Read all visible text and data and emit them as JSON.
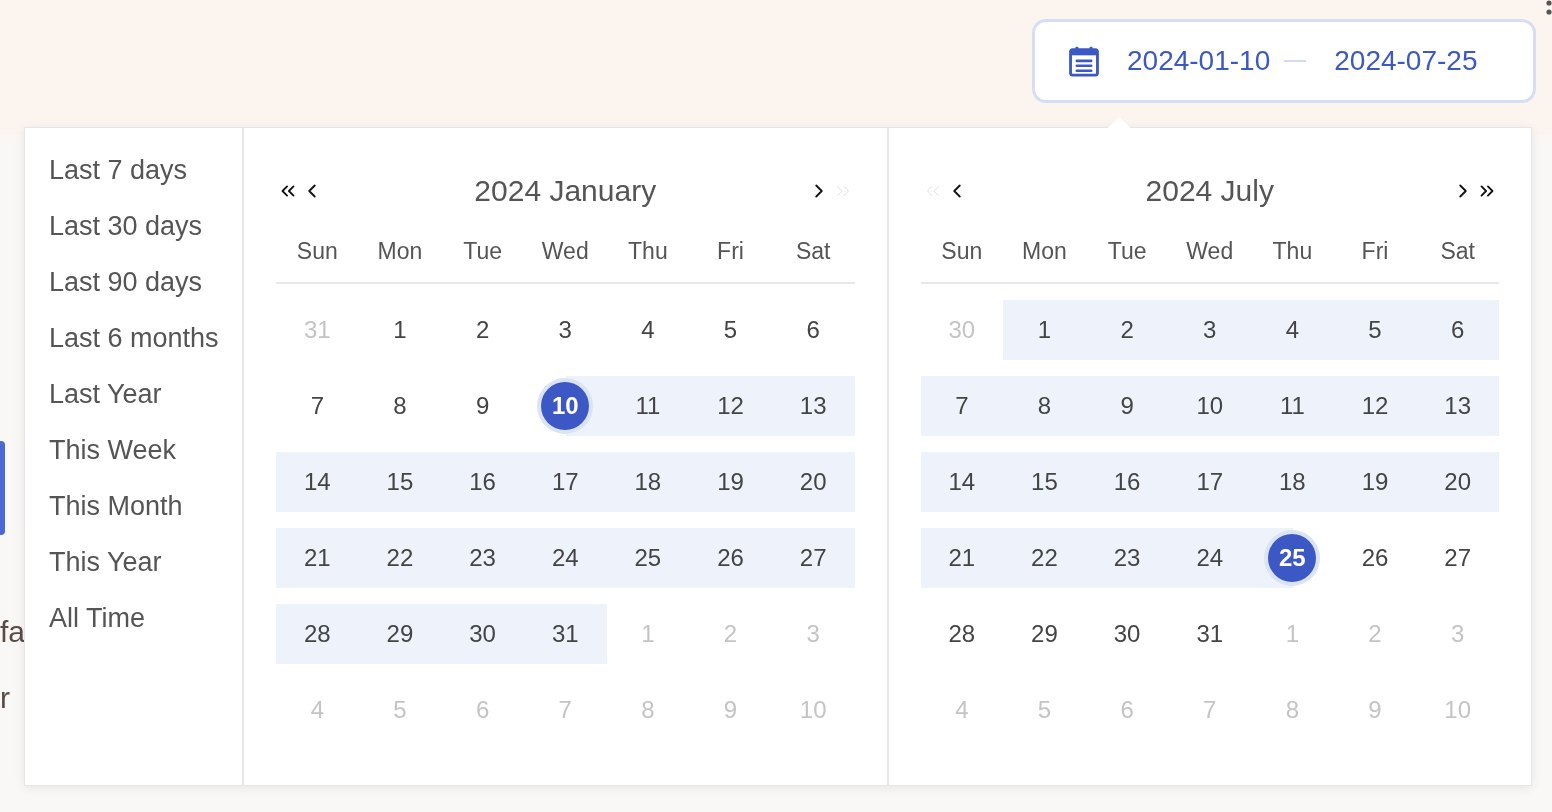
{
  "date_range_field": {
    "start": "2024-01-10",
    "end": "2024-07-25"
  },
  "background_fragments": [
    "fa",
    "r"
  ],
  "presets": [
    "Last 7 days",
    "Last 30 days",
    "Last 90 days",
    "Last 6 months",
    "Last Year",
    "This Week",
    "This Month",
    "This Year",
    "All Time"
  ],
  "calendars": [
    {
      "title": "2024 January",
      "nav": [
        {
          "kind": "prev_year",
          "disabled": false
        },
        {
          "kind": "prev_month",
          "disabled": false
        },
        {
          "kind": "next_month",
          "disabled": false
        },
        {
          "kind": "next_year",
          "disabled": true
        }
      ],
      "weekdays": [
        "Sun",
        "Mon",
        "Tue",
        "Wed",
        "Thu",
        "Fri",
        "Sat"
      ],
      "days": [
        {
          "label": "31",
          "outside": true,
          "in_range": false,
          "selected": false
        },
        {
          "label": "1",
          "outside": false,
          "in_range": false,
          "selected": false
        },
        {
          "label": "2",
          "outside": false,
          "in_range": false,
          "selected": false
        },
        {
          "label": "3",
          "outside": false,
          "in_range": false,
          "selected": false
        },
        {
          "label": "4",
          "outside": false,
          "in_range": false,
          "selected": false
        },
        {
          "label": "5",
          "outside": false,
          "in_range": false,
          "selected": false
        },
        {
          "label": "6",
          "outside": false,
          "in_range": false,
          "selected": false
        },
        {
          "label": "7",
          "outside": false,
          "in_range": false,
          "selected": false
        },
        {
          "label": "8",
          "outside": false,
          "in_range": false,
          "selected": false
        },
        {
          "label": "9",
          "outside": false,
          "in_range": false,
          "selected": false
        },
        {
          "label": "10",
          "outside": false,
          "in_range": true,
          "selected": true
        },
        {
          "label": "11",
          "outside": false,
          "in_range": true,
          "selected": false
        },
        {
          "label": "12",
          "outside": false,
          "in_range": true,
          "selected": false
        },
        {
          "label": "13",
          "outside": false,
          "in_range": true,
          "selected": false
        },
        {
          "label": "14",
          "outside": false,
          "in_range": true,
          "selected": false
        },
        {
          "label": "15",
          "outside": false,
          "in_range": true,
          "selected": false
        },
        {
          "label": "16",
          "outside": false,
          "in_range": true,
          "selected": false
        },
        {
          "label": "17",
          "outside": false,
          "in_range": true,
          "selected": false
        },
        {
          "label": "18",
          "outside": false,
          "in_range": true,
          "selected": false
        },
        {
          "label": "19",
          "outside": false,
          "in_range": true,
          "selected": false
        },
        {
          "label": "20",
          "outside": false,
          "in_range": true,
          "selected": false
        },
        {
          "label": "21",
          "outside": false,
          "in_range": true,
          "selected": false
        },
        {
          "label": "22",
          "outside": false,
          "in_range": true,
          "selected": false
        },
        {
          "label": "23",
          "outside": false,
          "in_range": true,
          "selected": false
        },
        {
          "label": "24",
          "outside": false,
          "in_range": true,
          "selected": false
        },
        {
          "label": "25",
          "outside": false,
          "in_range": true,
          "selected": false
        },
        {
          "label": "26",
          "outside": false,
          "in_range": true,
          "selected": false
        },
        {
          "label": "27",
          "outside": false,
          "in_range": true,
          "selected": false
        },
        {
          "label": "28",
          "outside": false,
          "in_range": true,
          "selected": false
        },
        {
          "label": "29",
          "outside": false,
          "in_range": true,
          "selected": false
        },
        {
          "label": "30",
          "outside": false,
          "in_range": true,
          "selected": false
        },
        {
          "label": "31",
          "outside": false,
          "in_range": true,
          "selected": false
        },
        {
          "label": "1",
          "outside": true,
          "in_range": false,
          "selected": false
        },
        {
          "label": "2",
          "outside": true,
          "in_range": false,
          "selected": false
        },
        {
          "label": "3",
          "outside": true,
          "in_range": false,
          "selected": false
        },
        {
          "label": "4",
          "outside": true,
          "in_range": false,
          "selected": false
        },
        {
          "label": "5",
          "outside": true,
          "in_range": false,
          "selected": false
        },
        {
          "label": "6",
          "outside": true,
          "in_range": false,
          "selected": false
        },
        {
          "label": "7",
          "outside": true,
          "in_range": false,
          "selected": false
        },
        {
          "label": "8",
          "outside": true,
          "in_range": false,
          "selected": false
        },
        {
          "label": "9",
          "outside": true,
          "in_range": false,
          "selected": false
        },
        {
          "label": "10",
          "outside": true,
          "in_range": false,
          "selected": false
        }
      ]
    },
    {
      "title": "2024 July",
      "nav": [
        {
          "kind": "prev_year",
          "disabled": true
        },
        {
          "kind": "prev_month",
          "disabled": false
        },
        {
          "kind": "next_month",
          "disabled": false
        },
        {
          "kind": "next_year",
          "disabled": false
        }
      ],
      "weekdays": [
        "Sun",
        "Mon",
        "Tue",
        "Wed",
        "Thu",
        "Fri",
        "Sat"
      ],
      "days": [
        {
          "label": "30",
          "outside": true,
          "in_range": false,
          "selected": false
        },
        {
          "label": "1",
          "outside": false,
          "in_range": true,
          "selected": false
        },
        {
          "label": "2",
          "outside": false,
          "in_range": true,
          "selected": false
        },
        {
          "label": "3",
          "outside": false,
          "in_range": true,
          "selected": false
        },
        {
          "label": "4",
          "outside": false,
          "in_range": true,
          "selected": false
        },
        {
          "label": "5",
          "outside": false,
          "in_range": true,
          "selected": false
        },
        {
          "label": "6",
          "outside": false,
          "in_range": true,
          "selected": false
        },
        {
          "label": "7",
          "outside": false,
          "in_range": true,
          "selected": false
        },
        {
          "label": "8",
          "outside": false,
          "in_range": true,
          "selected": false
        },
        {
          "label": "9",
          "outside": false,
          "in_range": true,
          "selected": false
        },
        {
          "label": "10",
          "outside": false,
          "in_range": true,
          "selected": false
        },
        {
          "label": "11",
          "outside": false,
          "in_range": true,
          "selected": false
        },
        {
          "label": "12",
          "outside": false,
          "in_range": true,
          "selected": false
        },
        {
          "label": "13",
          "outside": false,
          "in_range": true,
          "selected": false
        },
        {
          "label": "14",
          "outside": false,
          "in_range": true,
          "selected": false
        },
        {
          "label": "15",
          "outside": false,
          "in_range": true,
          "selected": false
        },
        {
          "label": "16",
          "outside": false,
          "in_range": true,
          "selected": false
        },
        {
          "label": "17",
          "outside": false,
          "in_range": true,
          "selected": false
        },
        {
          "label": "18",
          "outside": false,
          "in_range": true,
          "selected": false
        },
        {
          "label": "19",
          "outside": false,
          "in_range": true,
          "selected": false
        },
        {
          "label": "20",
          "outside": false,
          "in_range": true,
          "selected": false
        },
        {
          "label": "21",
          "outside": false,
          "in_range": true,
          "selected": false
        },
        {
          "label": "22",
          "outside": false,
          "in_range": true,
          "selected": false
        },
        {
          "label": "23",
          "outside": false,
          "in_range": true,
          "selected": false
        },
        {
          "label": "24",
          "outside": false,
          "in_range": true,
          "selected": false
        },
        {
          "label": "25",
          "outside": false,
          "in_range": true,
          "selected": true
        },
        {
          "label": "26",
          "outside": false,
          "in_range": false,
          "selected": false
        },
        {
          "label": "27",
          "outside": false,
          "in_range": false,
          "selected": false
        },
        {
          "label": "28",
          "outside": false,
          "in_range": false,
          "selected": false
        },
        {
          "label": "29",
          "outside": false,
          "in_range": false,
          "selected": false
        },
        {
          "label": "30",
          "outside": false,
          "in_range": false,
          "selected": false
        },
        {
          "label": "31",
          "outside": false,
          "in_range": false,
          "selected": false
        },
        {
          "label": "1",
          "outside": true,
          "in_range": false,
          "selected": false
        },
        {
          "label": "2",
          "outside": true,
          "in_range": false,
          "selected": false
        },
        {
          "label": "3",
          "outside": true,
          "in_range": false,
          "selected": false
        },
        {
          "label": "4",
          "outside": true,
          "in_range": false,
          "selected": false
        },
        {
          "label": "5",
          "outside": true,
          "in_range": false,
          "selected": false
        },
        {
          "label": "6",
          "outside": true,
          "in_range": false,
          "selected": false
        },
        {
          "label": "7",
          "outside": true,
          "in_range": false,
          "selected": false
        },
        {
          "label": "8",
          "outside": true,
          "in_range": false,
          "selected": false
        },
        {
          "label": "9",
          "outside": true,
          "in_range": false,
          "selected": false
        },
        {
          "label": "10",
          "outside": true,
          "in_range": false,
          "selected": false
        }
      ]
    }
  ]
}
